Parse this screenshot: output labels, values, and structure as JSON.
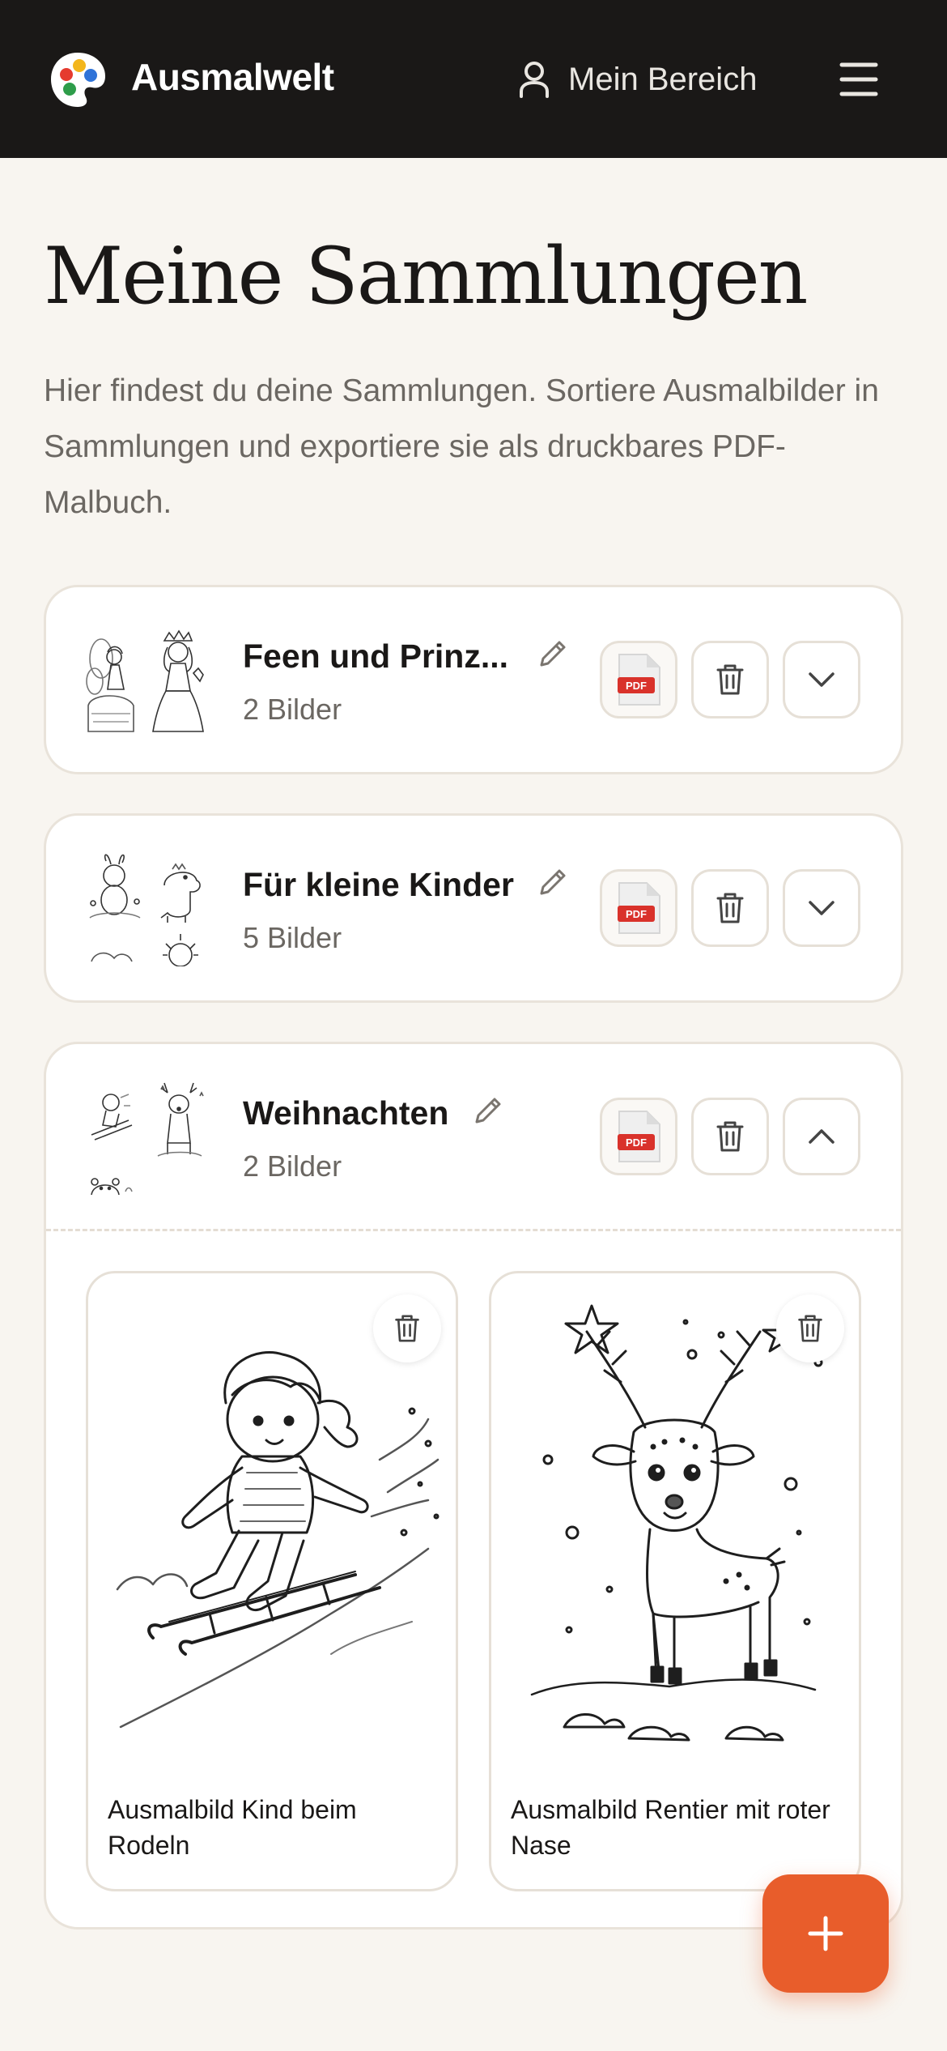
{
  "header": {
    "brand": "Ausmalwelt",
    "account_label": "Mein Bereich"
  },
  "page": {
    "title": "Meine Sammlungen",
    "intro": "Hier findest du deine Sammlungen. Sortiere Ausmalbilder in Sammlungen und exportiere sie als druckbares PDF-Malbuch."
  },
  "collections": [
    {
      "title": "Feen und Prinz...",
      "count": "2 Bilder",
      "expanded": false
    },
    {
      "title": "Für kleine Kinder",
      "count": "5 Bilder",
      "expanded": false
    },
    {
      "title": "Weihnachten",
      "count": "2 Bilder",
      "expanded": true,
      "images": [
        {
          "caption": "Ausmalbild Kind beim Rodeln"
        },
        {
          "caption": "Ausmalbild Rentier mit roter Nase"
        }
      ]
    }
  ],
  "pdf_badge": "PDF",
  "colors": {
    "header_bg": "#1a1817",
    "page_bg": "#f8f5f0",
    "accent": "#e85d2b",
    "pdf_red": "#d9322b"
  }
}
